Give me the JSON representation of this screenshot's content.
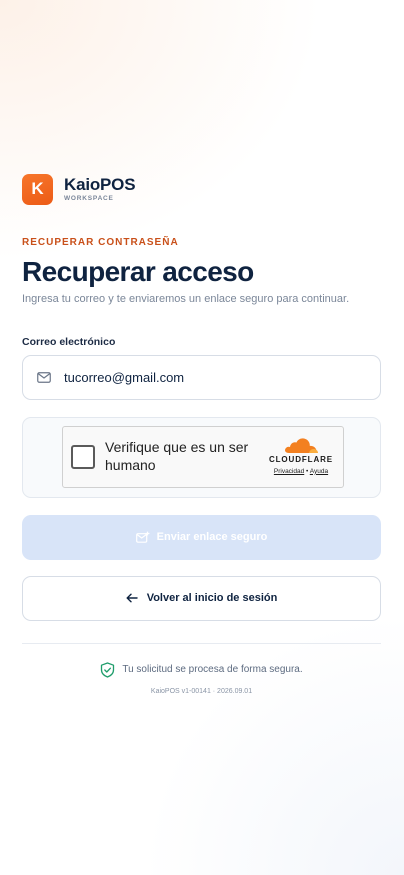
{
  "brand": {
    "logo_letter": "K",
    "name": "KaioPOS",
    "subtitle": "WORKSPACE",
    "accent_color": "#f0641d"
  },
  "page": {
    "eyebrow": "RECUPERAR CONTRASEÑA",
    "title": "Recuperar acceso",
    "subtitle": "Ingresa tu correo y te enviaremos un enlace seguro para continuar."
  },
  "form": {
    "email_label": "Correo electrónico",
    "email_value": "tucorreo@gmail.com",
    "email_icon": "mail-icon"
  },
  "captcha": {
    "label": "Verifique que es un ser humano",
    "provider": "CLOUDFLARE",
    "privacy_link": "Privacidad",
    "separator": "•",
    "help_link": "Ayuda"
  },
  "actions": {
    "submit_label": "Enviar enlace seguro",
    "submit_icon": "send-mail-icon",
    "submit_color": "#d8e4f8",
    "back_label": "Volver al inicio de sesión",
    "back_icon": "arrow-left-icon"
  },
  "footer": {
    "secure_text": "Tu solicitud se procesa de forma segura.",
    "secure_icon": "shield-check-icon",
    "secure_color": "#1f9d6b",
    "version": "KaioPOS v1-00141 · 2026.09.01"
  }
}
